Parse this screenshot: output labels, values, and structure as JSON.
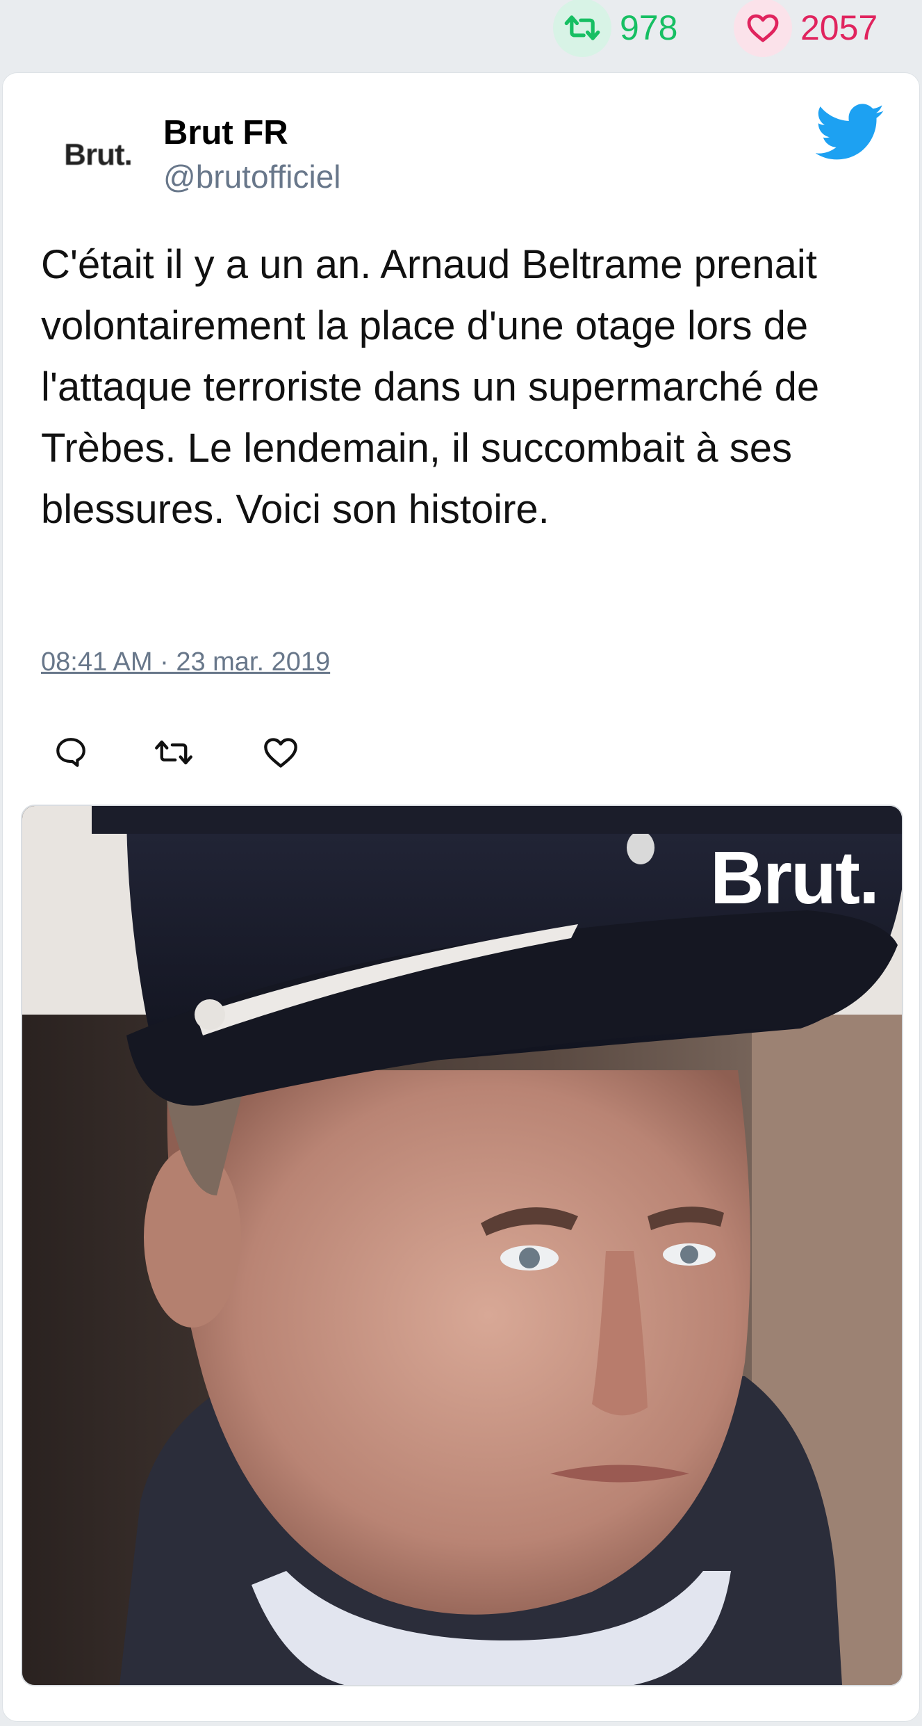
{
  "stats": {
    "retweet_count": "978",
    "like_count": "2057",
    "retweet_color": "#17bf63",
    "like_color": "#e0245e"
  },
  "author": {
    "avatar_logo_text": "Brut.",
    "name": "Brut FR",
    "handle": "@brutofficiel"
  },
  "tweet": {
    "text": "C'était il y a un an. Arnaud Beltrame prenait volontairement la place d'une otage lors de l'attaque terroriste dans un supermarché de Trèbes. Le lendemain, il succombait à ses blessures. Voici son histoire.",
    "timestamp": "08:41 AM · 23 mar. 2019"
  },
  "actions": {
    "reply_icon": "speech-bubble-icon",
    "retweet_icon": "retweet-icon",
    "like_icon": "heart-icon"
  },
  "media": {
    "watermark_text": "Brut."
  },
  "icons": {
    "brand": "twitter-bird-icon",
    "brand_color": "#1da1f2"
  }
}
